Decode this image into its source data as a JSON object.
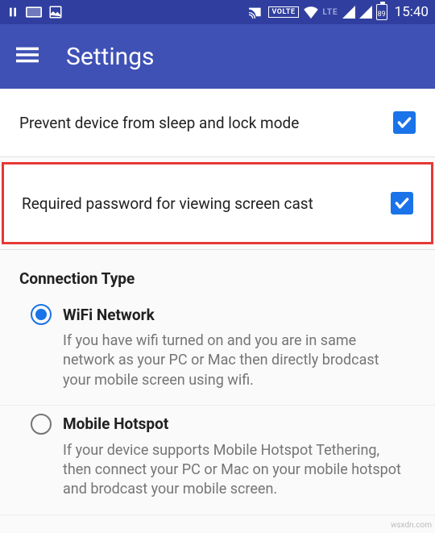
{
  "status": {
    "volte": "VOLTE",
    "lte": "LTE",
    "battery": "89",
    "time": "15:40"
  },
  "appbar": {
    "title": "Settings"
  },
  "rows": {
    "prevent_sleep": "Prevent device from sleep and lock mode",
    "require_password": "Required password for viewing screen cast"
  },
  "section": {
    "connection_type": "Connection Type"
  },
  "radios": {
    "wifi": {
      "title": "WiFi Network",
      "desc": "If you have wifi turned on and you are in same network as your PC or Mac then directly brodcast your mobile screen using wifi."
    },
    "hotspot": {
      "title": "Mobile Hotspot",
      "desc": "If your device supports Mobile Hotspot Tethering, then connect your PC or Mac on your mobile hotspot and brodcast your mobile screen."
    }
  },
  "watermark": "wsxdn.com"
}
